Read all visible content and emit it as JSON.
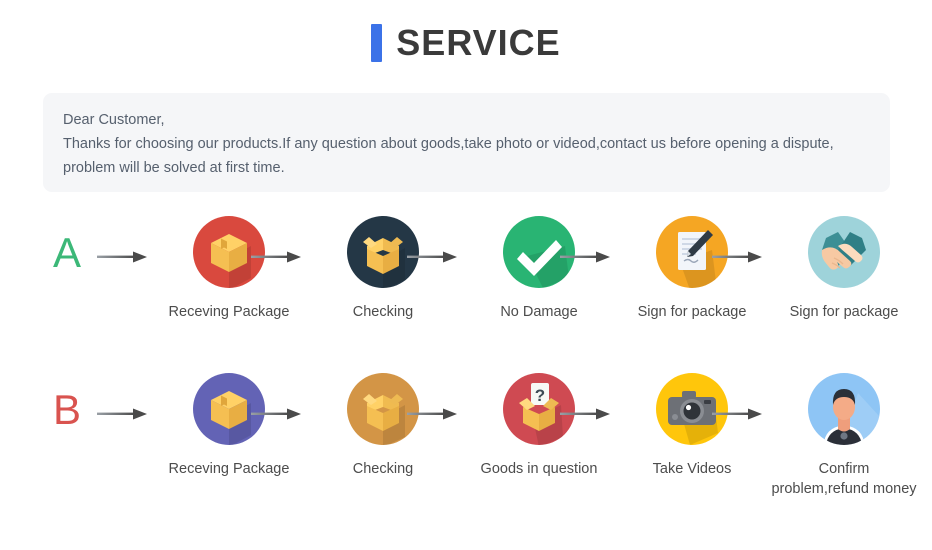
{
  "header": {
    "title": "SERVICE",
    "accent_color": "#3b72e8",
    "title_color": "#3a3a3a"
  },
  "notice": {
    "background": "#f5f6f8",
    "line1": "Dear Customer,",
    "line2": "Thanks for choosing our products.If any question about goods,take photo or videod,contact us before opening a dispute,",
    "line3": "problem will be solved at first time."
  },
  "flows": [
    {
      "letter": "A",
      "letter_color": "#3cb878",
      "steps": [
        {
          "label": "Receving Package",
          "icon": "closed-box-icon",
          "circle_color": "#d9493e"
        },
        {
          "label": "Checking",
          "icon": "open-box-icon",
          "circle_color": "#243746"
        },
        {
          "label": "No Damage",
          "icon": "check-mark-icon",
          "circle_color": "#29b473"
        },
        {
          "label": "Sign for package",
          "icon": "document-pen-icon",
          "circle_color": "#f5a623"
        },
        {
          "label": "Sign for package",
          "icon": "handshake-icon",
          "circle_color": "#9ed3da"
        }
      ]
    },
    {
      "letter": "B",
      "letter_color": "#d9534f",
      "steps": [
        {
          "label": "Receving Package",
          "icon": "closed-box-icon",
          "circle_color": "#6363b5"
        },
        {
          "label": "Checking",
          "icon": "open-box-icon",
          "circle_color": "#d39546"
        },
        {
          "label": "Goods in question",
          "icon": "question-box-icon",
          "circle_color": "#cf4a52"
        },
        {
          "label": "Take Videos",
          "icon": "camera-icon",
          "circle_color": "#ffc60b"
        },
        {
          "label": "Confirm problem,refund money",
          "icon": "person-avatar-icon",
          "circle_color": "#8ec5f5"
        }
      ]
    }
  ],
  "arrow": {
    "name": "right-arrow-icon",
    "color": "#4a4a4a"
  }
}
